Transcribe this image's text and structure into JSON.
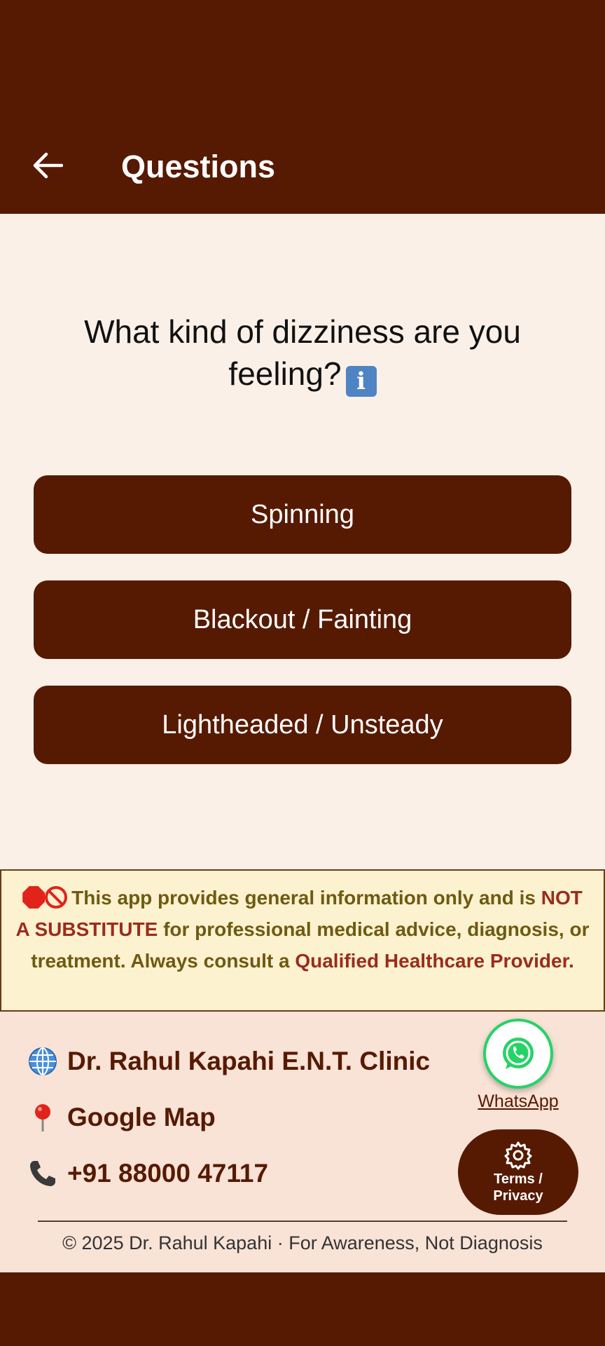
{
  "header": {
    "title": "Questions",
    "back_icon": "arrow-left-icon"
  },
  "question": {
    "text": "What kind of dizziness are you feeling?",
    "info_icon_text": "i"
  },
  "options": [
    {
      "label": "Spinning"
    },
    {
      "label": "Blackout / Fainting"
    },
    {
      "label": "Lightheaded / Unsteady"
    }
  ],
  "disclaimer": {
    "text_1": "This app provides general information only and is",
    "not_substitute": "NOT A SUBSTITUTE",
    "text_2": "for professional medical advice, diagnosis, or treatment. Always consult a",
    "provider": "Qualified Healthcare Provider",
    "end": "."
  },
  "footer": {
    "clinic": "Dr. Rahul Kapahi E.N.T. Clinic",
    "map": "Google Map",
    "phone": "+91 88000 47117",
    "whatsapp_label": "WhatsApp",
    "terms_label": "Terms / Privacy",
    "copyright": "© 2025 Dr. Rahul Kapahi · For Awareness, Not Diagnosis"
  },
  "colors": {
    "primary": "#561A03",
    "background": "#FBF0E8",
    "disclaimer_bg": "#FCF2CF",
    "footer_bg": "#F9E2D6",
    "whatsapp_green": "#25D366"
  }
}
